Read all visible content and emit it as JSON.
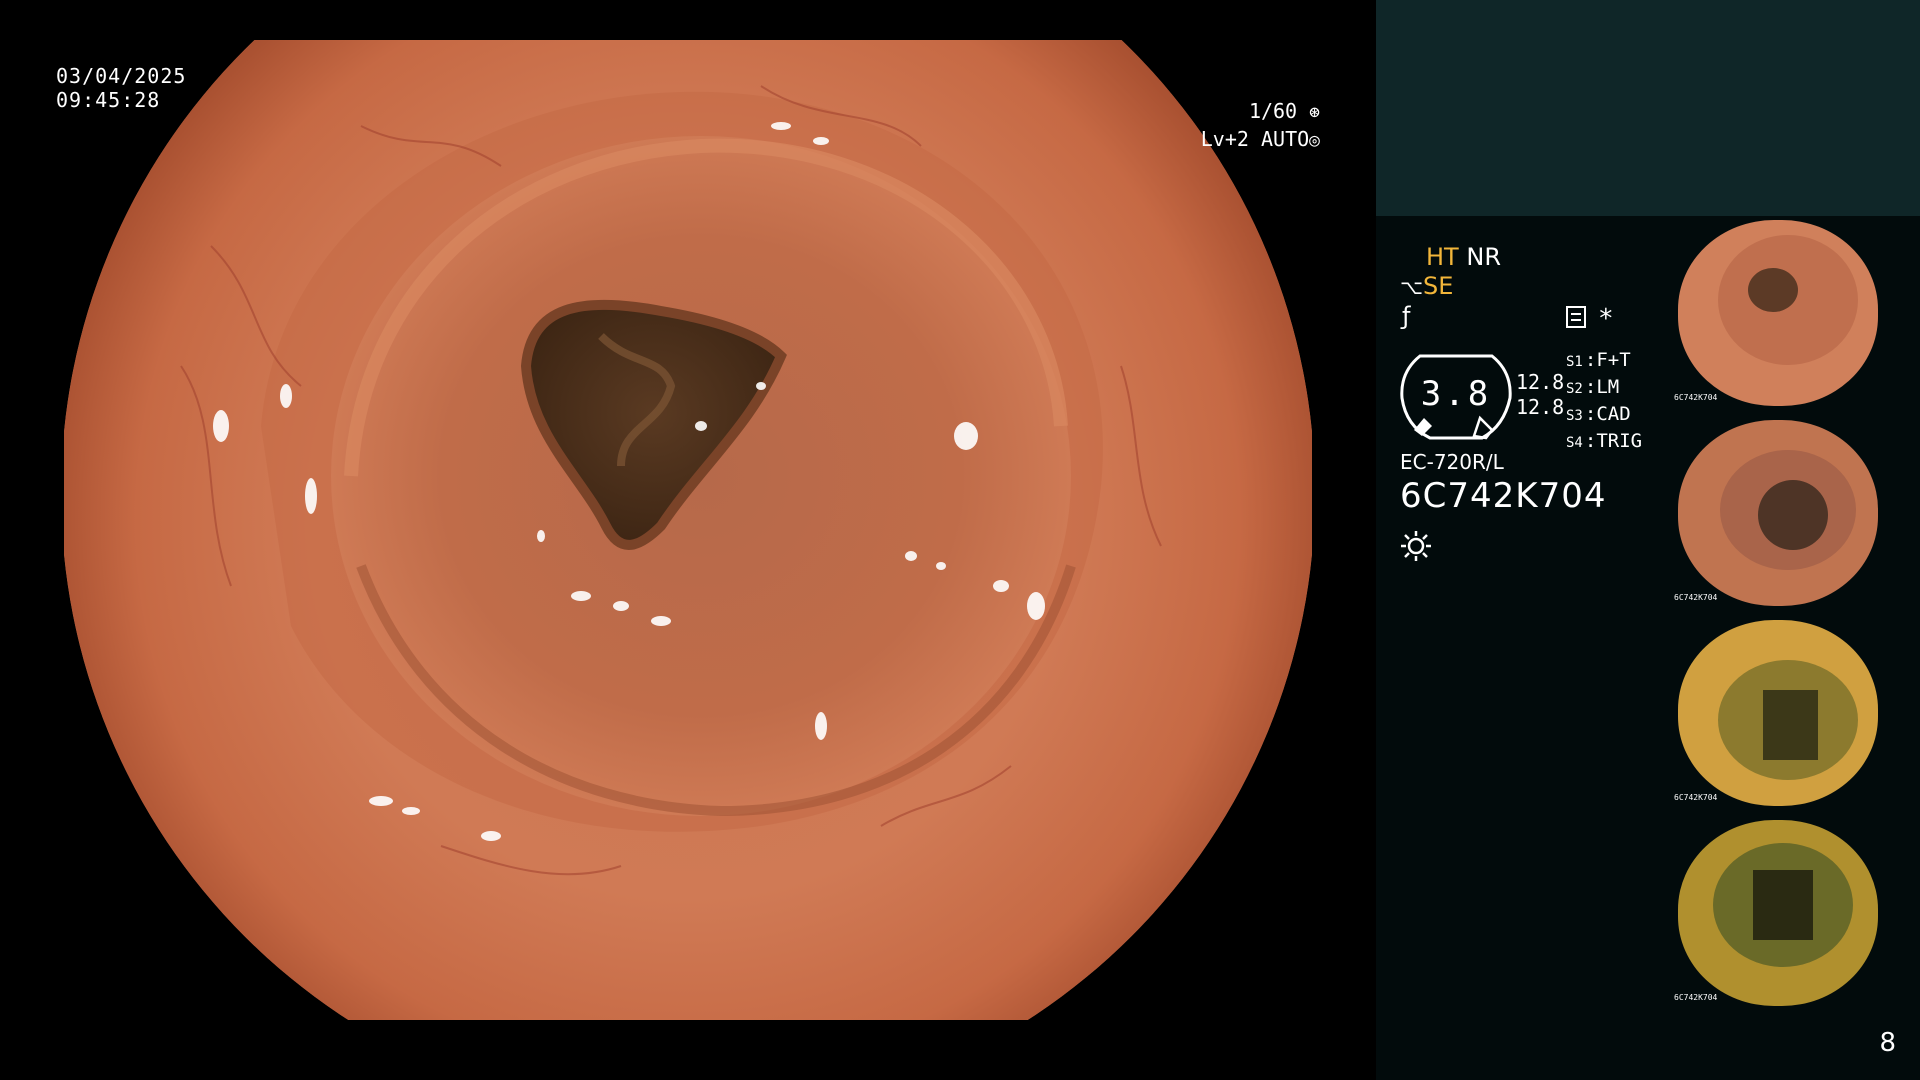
{
  "osd": {
    "date": "03/04/2025",
    "time": "09:45:28",
    "shutter": "1/60",
    "iris_level": "Lv+2",
    "iris_mode": "AUTO"
  },
  "panel": {
    "mode_ht": "HT",
    "mode_nr": "NR",
    "mode_se": "SE",
    "gauge_value": "3.8",
    "gauge_num1": "12.8",
    "gauge_num2": "12.8",
    "slots": [
      {
        "key": "S1",
        "value": "F+T"
      },
      {
        "key": "S2",
        "value": "LM"
      },
      {
        "key": "S3",
        "value": "CAD"
      },
      {
        "key": "S4",
        "value": "TRIG"
      }
    ],
    "scope_model": "EC-720R/L",
    "scope_serial": "6C742K704",
    "page_number": "8",
    "accent_color": "#f2b63a"
  },
  "thumbnails": [
    {
      "serial": "6C742K704",
      "tone": "pink-orange"
    },
    {
      "serial": "6C742K704",
      "tone": "orange-brown"
    },
    {
      "serial": "6C742K704",
      "tone": "yellow-green"
    },
    {
      "serial": "6C742K704",
      "tone": "green-yellow"
    }
  ]
}
